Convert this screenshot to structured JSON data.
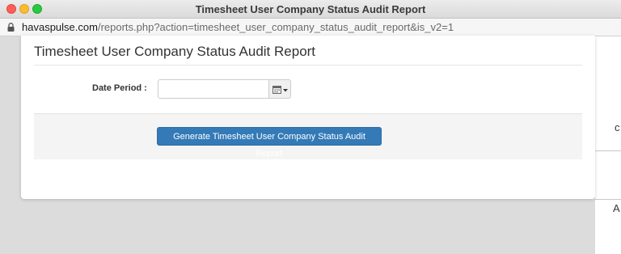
{
  "window": {
    "title": "Timesheet User Company Status Audit Report"
  },
  "address_bar": {
    "host": "havaspulse.com",
    "path": "/reports.php?action=timesheet_user_company_status_audit_report&is_v2=1"
  },
  "report": {
    "title": "Timesheet User Company Status Audit Report",
    "date_period_label": "Date Period :",
    "date_period_value": "",
    "generate_button": "Generate Timesheet User Company Status Audit Report"
  },
  "background_fragments": {
    "glyph_1": "c",
    "glyph_2": "A"
  },
  "colors": {
    "primary_button": "#337ab7",
    "panel_background": "#ffffff",
    "footer_background": "#f4f4f4"
  },
  "icons": [
    "lock-icon",
    "calendar-icon",
    "caret-down-icon"
  ]
}
